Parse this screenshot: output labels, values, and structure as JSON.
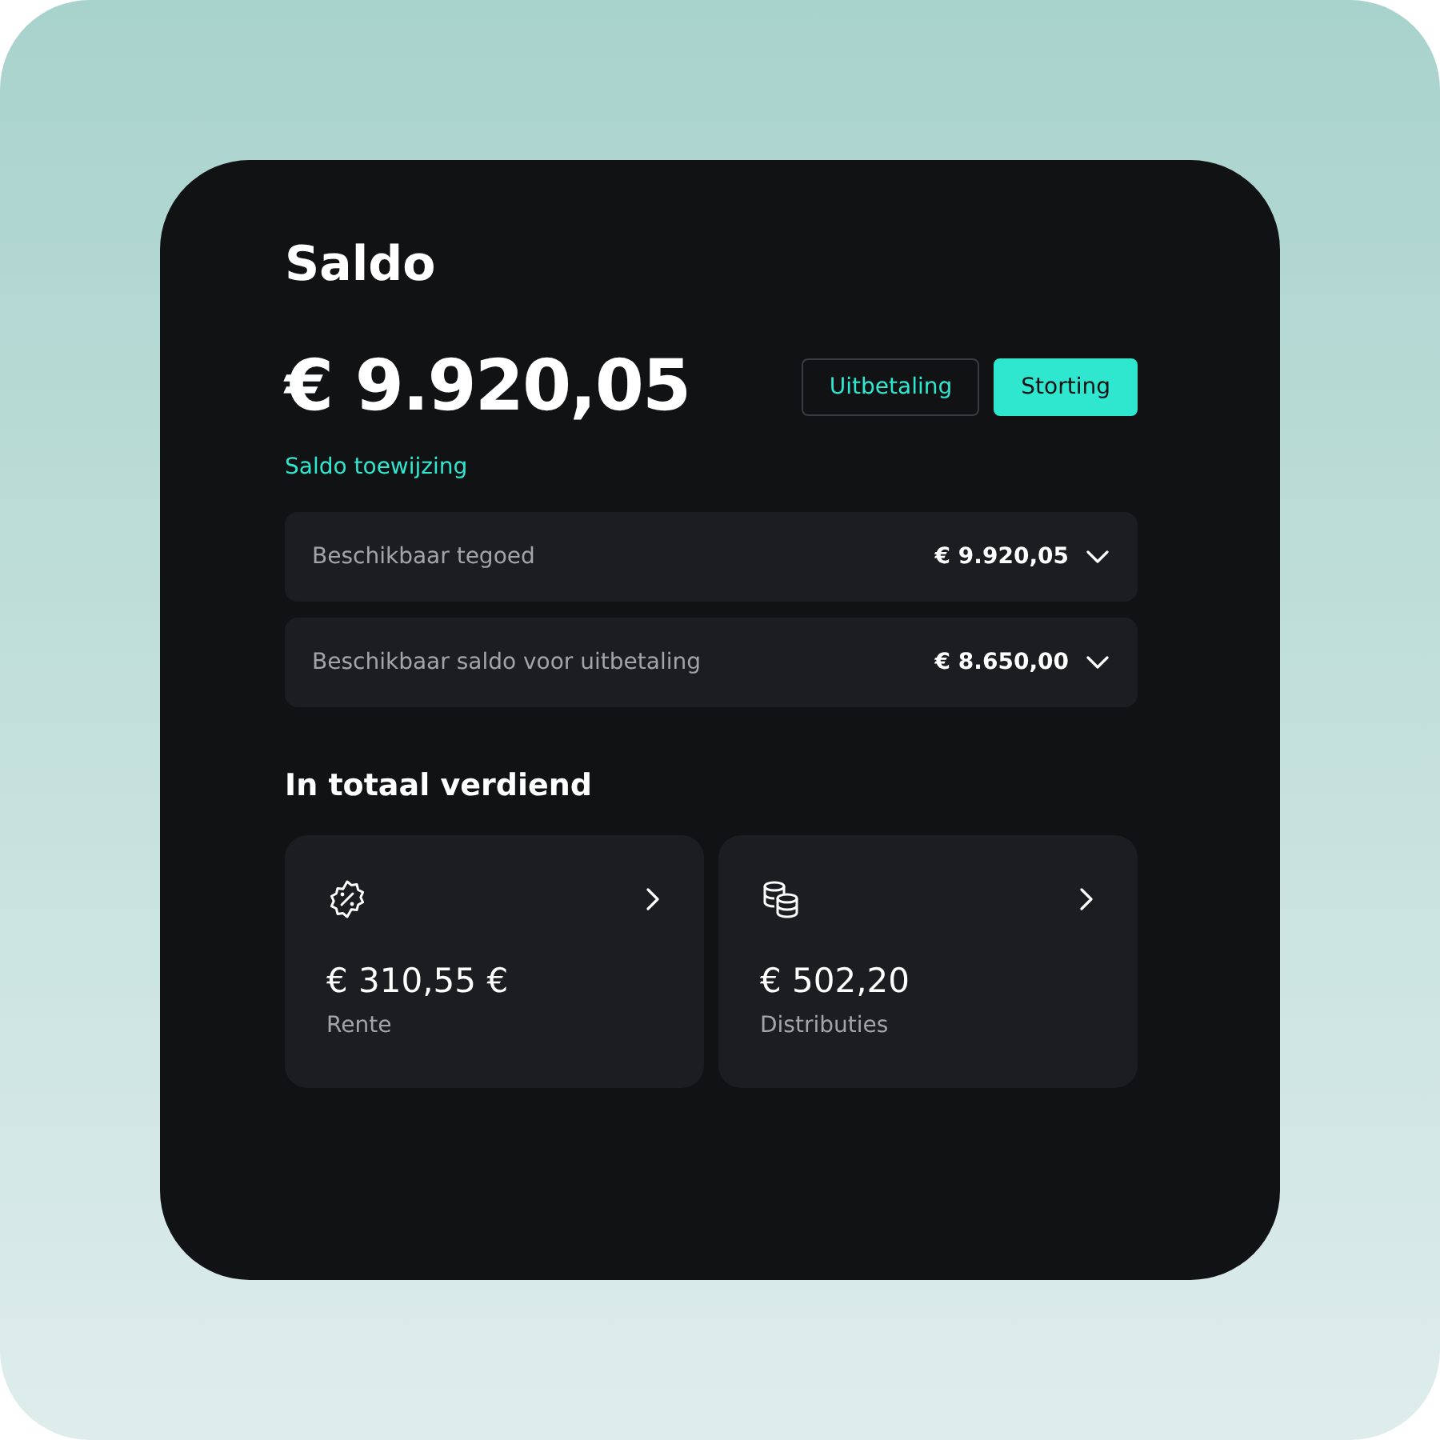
{
  "title": "Saldo",
  "balance": "€ 9.920,05",
  "buttons": [
    {
      "label": "Uitbetaling",
      "kind": "outline"
    },
    {
      "label": "Storting",
      "kind": "primary"
    }
  ],
  "link": "Saldo toewijzing",
  "rows": [
    {
      "label": "Beschikbaar tegoed",
      "value": "€ 9.920,05",
      "expanded": false
    },
    {
      "label": "Beschikbaar saldo voor uitbetaling",
      "value": "€ 8.650,00",
      "expanded": false
    }
  ],
  "earned": {
    "heading": "In totaal verdiend",
    "cards": [
      {
        "kind": "percent",
        "amount": "€ 310,55 €",
        "label": "Rente"
      },
      {
        "kind": "coins",
        "amount": "€ 502,20",
        "label": "Distributies"
      }
    ]
  }
}
